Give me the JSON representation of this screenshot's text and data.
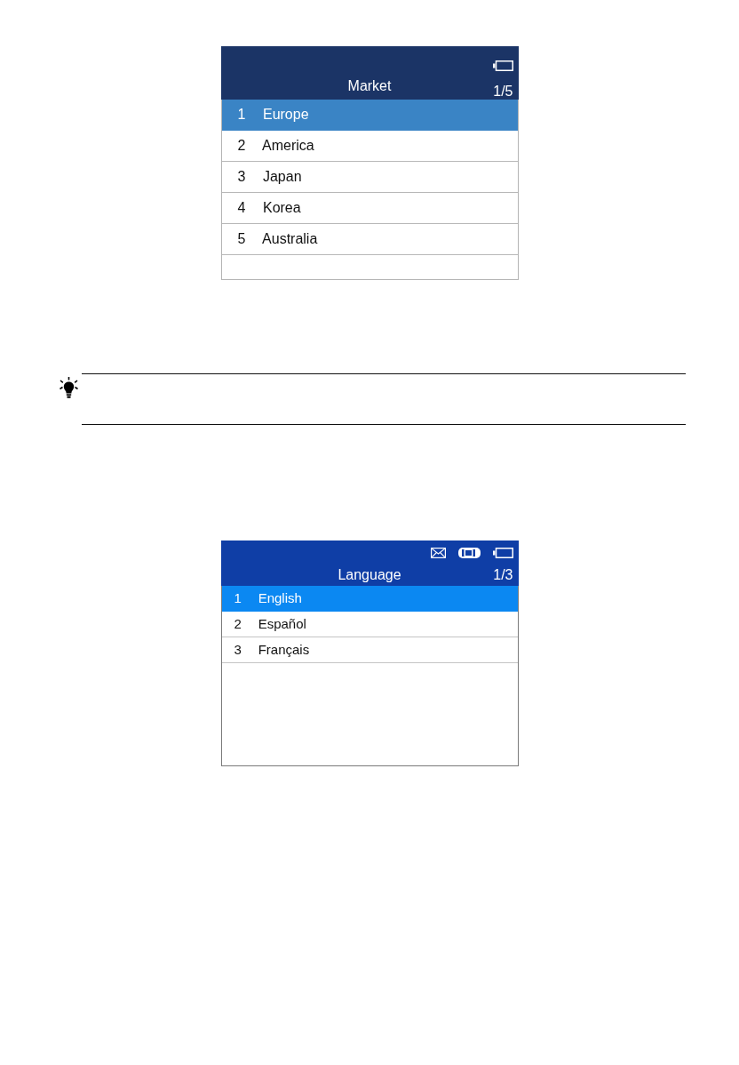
{
  "screens": [
    {
      "kind": "large",
      "title": "Market",
      "page": "1/5",
      "items": [
        {
          "number": "1",
          "label": "Europe",
          "selected": true
        },
        {
          "number": "2",
          "label": "America",
          "selected": false
        },
        {
          "number": "3",
          "label": "Japan",
          "selected": false
        },
        {
          "number": "4",
          "label": "Korea",
          "selected": false
        },
        {
          "number": "5",
          "label": "Australia",
          "selected": false
        }
      ]
    },
    {
      "kind": "compact",
      "title": "Language",
      "page": "1/3",
      "items": [
        {
          "number": "1",
          "label": "English",
          "selected": true
        },
        {
          "number": "2",
          "label": "Español",
          "selected": false
        },
        {
          "number": "3",
          "label": "Français",
          "selected": false
        }
      ]
    }
  ]
}
